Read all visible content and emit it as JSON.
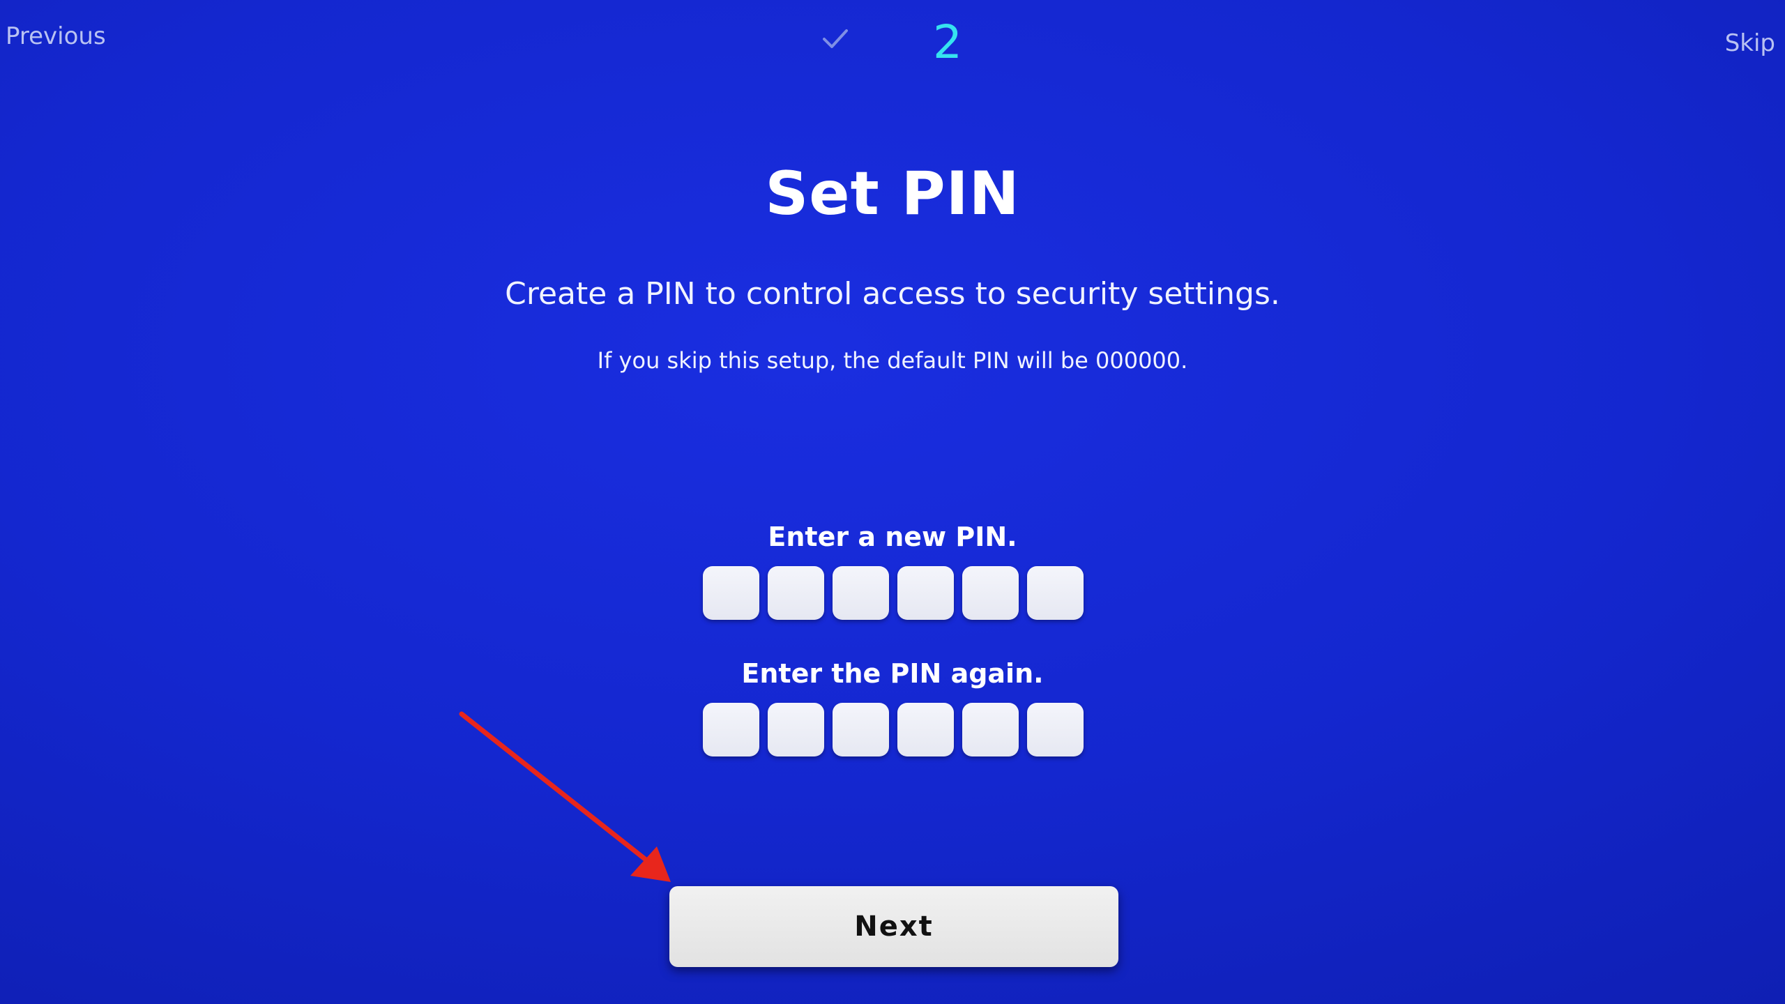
{
  "nav": {
    "previous_label": "Previous",
    "skip_label": "Skip"
  },
  "steps": {
    "completed_icon": "check-icon",
    "current_step": "2"
  },
  "main": {
    "title": "Set PIN",
    "subtitle": "Create a PIN to control access to security settings.",
    "note": "If you skip this setup, the default PIN will be 000000.",
    "new_pin_label": "Enter a new PIN.",
    "confirm_pin_label": "Enter the PIN again.",
    "pin_length": 6
  },
  "actions": {
    "next_label": "Next"
  },
  "annotation": {
    "icon": "red-arrow-icon",
    "color": "#e8261c"
  },
  "colors": {
    "background": "#1427cf",
    "accent_step": "#36e3ef"
  }
}
